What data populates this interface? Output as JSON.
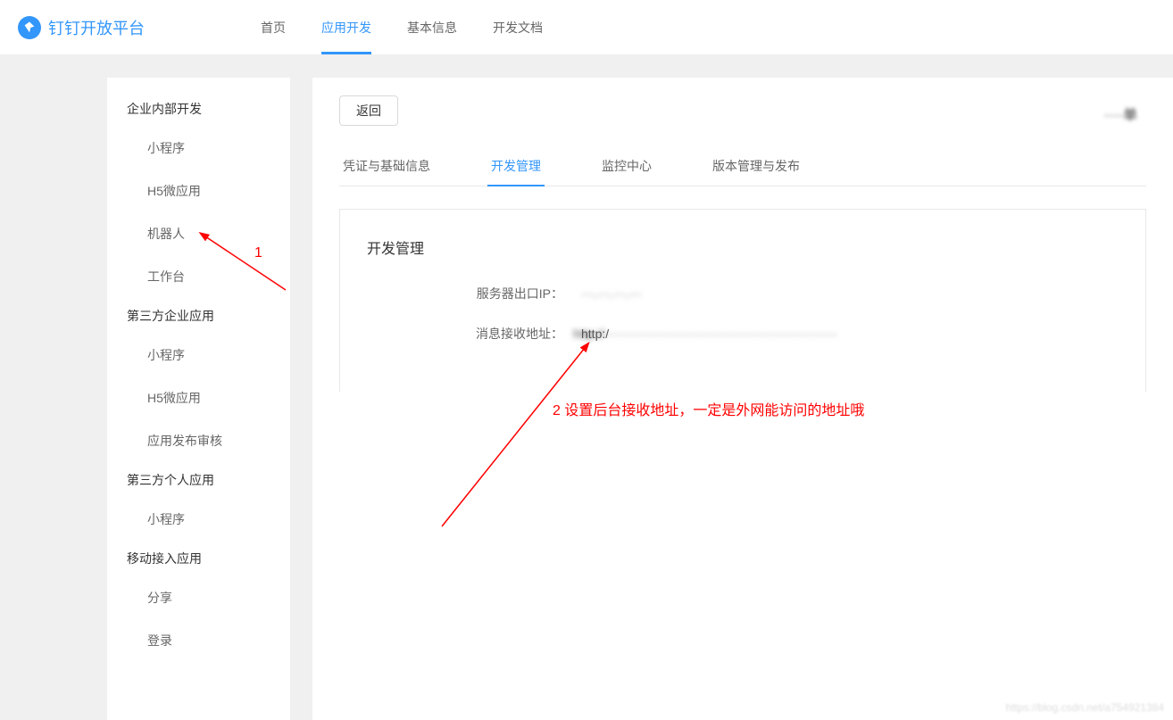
{
  "header": {
    "brand": "钉钉开放平台",
    "nav": [
      {
        "label": "首页",
        "active": false
      },
      {
        "label": "应用开发",
        "active": true
      },
      {
        "label": "基本信息",
        "active": false
      },
      {
        "label": "开发文档",
        "active": false
      }
    ]
  },
  "sidebar": [
    {
      "title": "企业内部开发",
      "items": [
        "小程序",
        "H5微应用",
        "机器人",
        "工作台"
      ]
    },
    {
      "title": "第三方企业应用",
      "items": [
        "小程序",
        "H5微应用",
        "应用发布审核"
      ]
    },
    {
      "title": "第三方个人应用",
      "items": [
        "小程序"
      ]
    },
    {
      "title": "移动接入应用",
      "items": [
        "分享",
        "登录"
      ]
    }
  ],
  "main": {
    "back_label": "返回",
    "app_name_obscured": "····单",
    "tabs": [
      {
        "label": "凭证与基础信息",
        "active": false
      },
      {
        "label": "开发管理",
        "active": true
      },
      {
        "label": "监控中心",
        "active": false
      },
      {
        "label": "版本管理与发布",
        "active": false
      }
    ],
    "panel": {
      "title": "开发管理",
      "server_ip_label": "服务器出口IP：",
      "server_ip_value_obscured": "···.···.···.···",
      "receive_url_label": "消息接收地址：",
      "receive_url_value_obscured": "http://························································"
    }
  },
  "annotations": {
    "one": "1",
    "two": "2 设置后台接收地址，一定是外网能访问的地址哦"
  },
  "watermark": "https://blog.csdn.net/a754921384"
}
